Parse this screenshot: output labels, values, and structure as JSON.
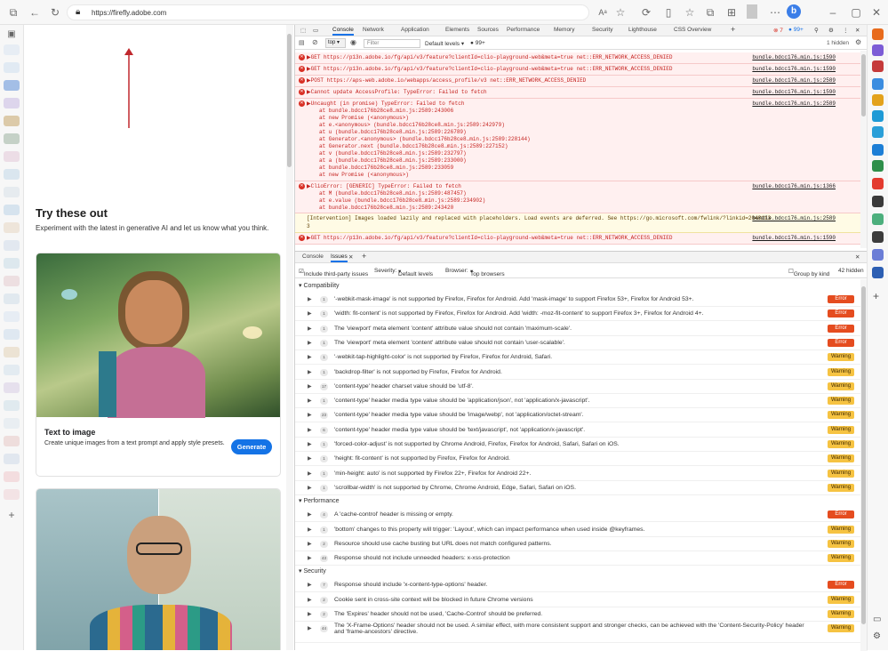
{
  "browser": {
    "url": "https://firefly.adobe.com"
  },
  "page": {
    "title": "Try these out",
    "subtitle": "Experiment with the latest in generative AI and let us know what you think.",
    "card1_title": "Text to image",
    "card1_desc": "Create unique images from a text prompt and apply style presets.",
    "card1_button": "Generate"
  },
  "devtools": {
    "tabs": [
      "Console",
      "Network",
      "Application",
      "Elements",
      "Sources",
      "Performance",
      "Memory",
      "Security",
      "Lighthouse",
      "CSS Overview"
    ],
    "errors_count": "7",
    "issues_count": "99+",
    "context": "top",
    "filter_placeholder": "Filter",
    "levels": "Default levels",
    "msg_count": "99+",
    "hidden": "1 hidden",
    "console_rows": [
      {
        "msg": "▶GET https://p13n.adobe.io/fg/api/v3/feature?clientId=clio-playground-web&meta=true net::ERR_NETWORK_ACCESS_DENIED",
        "src": "bundle.bdcc176…min.js:1590"
      },
      {
        "msg": "▶GET https://p13n.adobe.io/fg/api/v3/feature?clientId=clio-playground-web&meta=true net::ERR_NETWORK_ACCESS_DENIED",
        "src": "bundle.bdcc176…min.js:1590"
      },
      {
        "msg": "▶POST https://aps-web.adobe.io/webapps/access_profile/v3 net::ERR_NETWORK_ACCESS_DENIED",
        "src": "bundle.bdcc176…min.js:2589"
      },
      {
        "msg": "▶Cannot update AccessProfile: TypeError: Failed to fetch",
        "src": "bundle.bdcc176…min.js:1590"
      }
    ],
    "uncaught_title": "▶Uncaught (in promise) TypeError: Failed to fetch",
    "uncaught_src": "bundle.bdcc176…min.js:2589",
    "stack": [
      "at bundle.bdcc176b28ce8…min.js:2589:243006",
      "at new Promise (<anonymous>)",
      "at e.<anonymous> (bundle.bdcc176b28ce8…min.js:2589:242979)",
      "at u (bundle.bdcc176b28ce8…min.js:2589:226789)",
      "at Generator.<anonymous> (bundle.bdcc176b28ce8…min.js:2589:228144)",
      "at Generator.next (bundle.bdcc176b28ce8…min.js:2589:227152)",
      "at v (bundle.bdcc176b28ce8…min.js:2589:232797)",
      "at a (bundle.bdcc176b28ce8…min.js:2589:233000)",
      "at bundle.bdcc176b28ce8…min.js:2589:233059",
      "at new Promise (<anonymous>)"
    ],
    "clio_title": "▶ClioError: [GENERIC] TypeError: Failed to fetch",
    "clio_src": "bundle.bdcc176…min.js:1366",
    "clio_stack": [
      "at M (bundle.bdcc176b28ce8…min.js:2589:487457)",
      "at e.value (bundle.bdcc176b28ce8…min.js:2589:234902)",
      "at bundle.bdcc176b28ce8…min.js:2589:243420"
    ],
    "intervention": "[Intervention] Images loaded lazily and replaced with placeholders. Load events are deferred. See https://go.microsoft.com/fwlink/?linkid=2048113",
    "intervention_src": "bundle.bdcc176…min.js:2589",
    "last_row": {
      "msg": "▶GET https://p13n.adobe.io/fg/api/v3/feature?clientId=clio-playground-web&meta=true net::ERR_NETWORK_ACCESS_DENIED",
      "src": "bundle.bdcc176…min.js:1590"
    }
  },
  "drawer": {
    "tabs": [
      "Console",
      "Issues"
    ],
    "include_third_party": "Include third-party issues",
    "severity": "Severity:",
    "severity_val": "Default levels",
    "browser": "Browser:",
    "browser_val": "Top browsers",
    "group_by_kind": "Group by kind",
    "hidden": "42 hidden"
  },
  "issues": {
    "compat_label": "Compatibility",
    "perf_label": "Performance",
    "sec_label": "Security",
    "compat": [
      {
        "count": "1",
        "text": "'-webkit-mask-image' is not supported by Firefox, Firefox for Android. Add 'mask-image' to support Firefox 53+, Firefox for Android 53+.",
        "level": "Error"
      },
      {
        "count": "1",
        "text": "'width: fit-content' is not supported by Firefox, Firefox for Android. Add 'width: -moz-fit-content' to support Firefox 3+, Firefox for Android 4+.",
        "level": "Error"
      },
      {
        "count": "1",
        "text": "The 'viewport' meta element 'content' attribute value should not contain 'maximum-scale'.",
        "level": "Error"
      },
      {
        "count": "1",
        "text": "The 'viewport' meta element 'content' attribute value should not contain 'user-scalable'.",
        "level": "Error"
      },
      {
        "count": "1",
        "text": "'-webkit-tap-highlight-color' is not supported by Firefox, Firefox for Android, Safari.",
        "level": "Warning"
      },
      {
        "count": "1",
        "text": "'backdrop-filter' is not supported by Firefox, Firefox for Android.",
        "level": "Warning"
      },
      {
        "count": "17",
        "text": "'content-type' header charset value should be 'utf-8'.",
        "level": "Warning"
      },
      {
        "count": "1",
        "text": "'content-type' header media type value should be 'application/json', not 'application/x-javascript'.",
        "level": "Warning"
      },
      {
        "count": "23",
        "text": "'content-type' header media type value should be 'image/webp', not 'application/octet-stream'.",
        "level": "Warning"
      },
      {
        "count": "6",
        "text": "'content-type' header media type value should be 'text/javascript', not 'application/x-javascript'.",
        "level": "Warning"
      },
      {
        "count": "1",
        "text": "'forced-color-adjust' is not supported by Chrome Android, Firefox, Firefox for Android, Safari, Safari on iOS.",
        "level": "Warning"
      },
      {
        "count": "1",
        "text": "'height: fit-content' is not supported by Firefox, Firefox for Android.",
        "level": "Warning"
      },
      {
        "count": "1",
        "text": "'min-height: auto' is not supported by Firefox 22+, Firefox for Android 22+.",
        "level": "Warning"
      },
      {
        "count": "1",
        "text": "'scrollbar-width' is not supported by Chrome, Chrome Android, Edge, Safari, Safari on iOS.",
        "level": "Warning"
      }
    ],
    "perf": [
      {
        "count": "4",
        "text": "A 'cache-control' header is missing or empty.",
        "level": "Error"
      },
      {
        "count": "1",
        "text": "'bottom' changes to this property will trigger: 'Layout', which can impact performance when used inside @keyframes.",
        "level": "Warning"
      },
      {
        "count": "2",
        "text": "Resource should use cache busting but URL does not match configured patterns.",
        "level": "Warning"
      },
      {
        "count": "43",
        "text": "Response should not include unneeded headers: x-xss-protection",
        "level": "Warning"
      }
    ],
    "sec": [
      {
        "count": "7",
        "text": "Response should include 'x-content-type-options' header.",
        "level": "Error"
      },
      {
        "count": "2",
        "text": "Cookie sent in cross-site context will be blocked in future Chrome versions",
        "level": "Warning"
      },
      {
        "count": "2",
        "text": "The 'Expires' header should not be used, 'Cache-Control' should be preferred.",
        "level": "Warning"
      },
      {
        "count": "44",
        "text": "The 'X-Frame-Options' header should not be used. A similar effect, with more consistent support and stronger checks, can be achieved with the 'Content-Security-Policy' header and 'frame-ancestors' directive.",
        "level": "Warning"
      }
    ]
  },
  "colors": {
    "accent": "#1473e6",
    "error": "#e54c1f",
    "warning": "#f6c342"
  }
}
